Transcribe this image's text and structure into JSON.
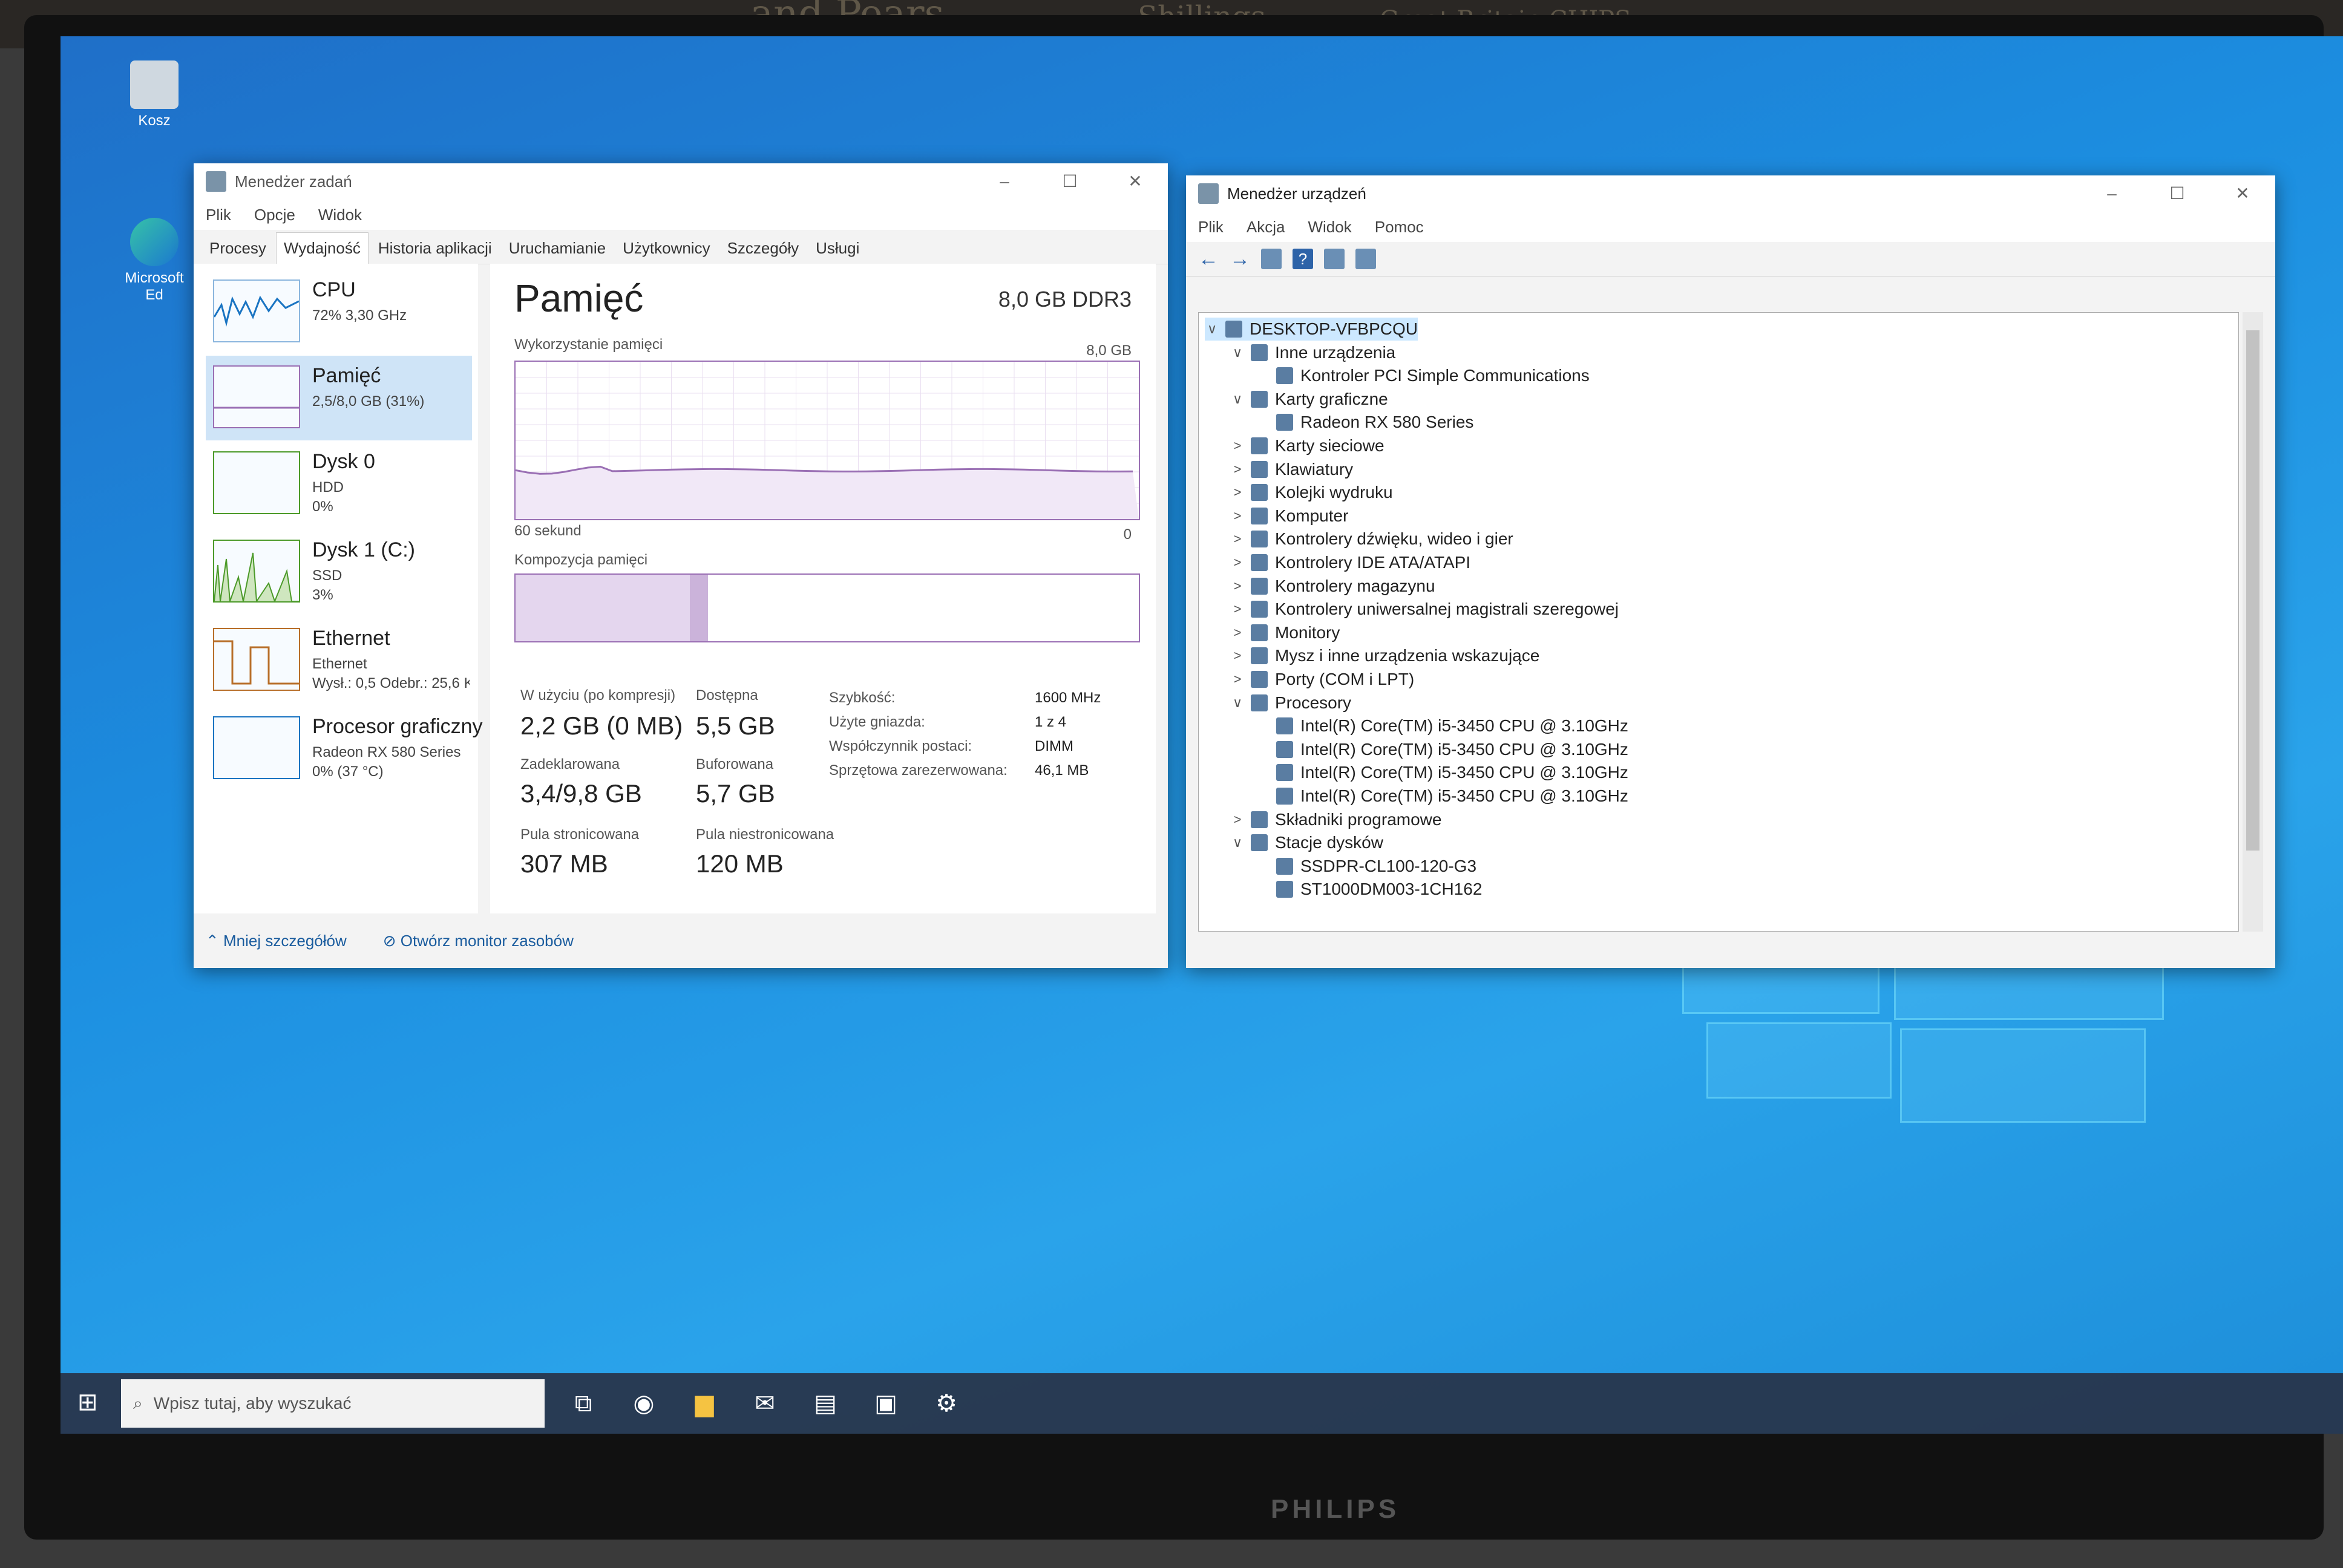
{
  "desktop": {
    "icons": [
      {
        "label": "Kosz"
      },
      {
        "label": "Microsoft Ed"
      }
    ],
    "taskbar": {
      "search_placeholder": "Wpisz tutaj, aby wyszukać"
    },
    "monitor_brand": "PHILIPS",
    "background_books": [
      "and Pears",
      "Shillings",
      "Great Britain CHIPS"
    ]
  },
  "task_manager": {
    "title": "Menedżer zadań",
    "menu": [
      "Plik",
      "Opcje",
      "Widok"
    ],
    "tabs": [
      "Procesy",
      "Wydajność",
      "Historia aplikacji",
      "Uruchamianie",
      "Użytkownicy",
      "Szczegóły",
      "Usługi"
    ],
    "active_tab": "Wydajność",
    "sidebar": [
      {
        "name": "CPU",
        "sub1": "72% 3,30 GHz",
        "sub2": ""
      },
      {
        "name": "Pamięć",
        "sub1": "2,5/8,0 GB (31%)",
        "sub2": ""
      },
      {
        "name": "Dysk 0",
        "sub1": "HDD",
        "sub2": "0%"
      },
      {
        "name": "Dysk 1 (C:)",
        "sub1": "SSD",
        "sub2": "3%"
      },
      {
        "name": "Ethernet",
        "sub1": "Ethernet",
        "sub2": "Wysł.: 0,5 Odebr.: 25,6 K"
      },
      {
        "name": "Procesor graficzny",
        "sub1": "Radeon RX 580 Series",
        "sub2": "0% (37 °C)"
      }
    ],
    "memory": {
      "title": "Pamięć",
      "spec": "8,0 GB DDR3",
      "usage_label": "Wykorzystanie pamięci",
      "usage_max": "8,0 GB",
      "time_label": "60 sekund",
      "time_end": "0",
      "composition_label": "Kompozycja pamięci",
      "in_use_label": "W użyciu (po kompresji)",
      "in_use_value": "2,2 GB (0 MB)",
      "available_label": "Dostępna",
      "available_value": "5,5 GB",
      "committed_label": "Zadeklarowana",
      "committed_value": "3,4/9,8 GB",
      "cached_label": "Buforowana",
      "cached_value": "5,7 GB",
      "paged_label": "Pula stronicowana",
      "paged_value": "307 MB",
      "nonpaged_label": "Pula niestronicowana",
      "nonpaged_value": "120 MB",
      "speed_label": "Szybkość:",
      "speed_value": "1600 MHz",
      "slots_label": "Użyte gniazda:",
      "slots_value": "1 z 4",
      "form_label": "Współczynnik postaci:",
      "form_value": "DIMM",
      "reserved_label": "Sprzętowa zarezerwowana:",
      "reserved_value": "46,1 MB",
      "usage_fraction": 0.31
    },
    "footer": {
      "less": "Mniej szczegółów",
      "monitor": "Otwórz monitor zasobów"
    }
  },
  "device_manager": {
    "title": "Menedżer urządzeń",
    "menu": [
      "Plik",
      "Akcja",
      "Widok",
      "Pomoc"
    ],
    "tree": [
      {
        "label": "DESKTOP-VFBPCQU",
        "exp": "∨",
        "level": 0
      },
      {
        "label": "Inne urządzenia",
        "exp": "∨",
        "level": 1
      },
      {
        "label": "Kontroler PCI Simple Communications",
        "exp": "",
        "level": 2
      },
      {
        "label": "Karty graficzne",
        "exp": "∨",
        "level": 1
      },
      {
        "label": "Radeon RX 580 Series",
        "exp": "",
        "level": 2
      },
      {
        "label": "Karty sieciowe",
        "exp": ">",
        "level": 1
      },
      {
        "label": "Klawiatury",
        "exp": ">",
        "level": 1
      },
      {
        "label": "Kolejki wydruku",
        "exp": ">",
        "level": 1
      },
      {
        "label": "Komputer",
        "exp": ">",
        "level": 1
      },
      {
        "label": "Kontrolery dźwięku, wideo i gier",
        "exp": ">",
        "level": 1
      },
      {
        "label": "Kontrolery IDE ATA/ATAPI",
        "exp": ">",
        "level": 1
      },
      {
        "label": "Kontrolery magazynu",
        "exp": ">",
        "level": 1
      },
      {
        "label": "Kontrolery uniwersalnej magistrali szeregowej",
        "exp": ">",
        "level": 1
      },
      {
        "label": "Monitory",
        "exp": ">",
        "level": 1
      },
      {
        "label": "Mysz i inne urządzenia wskazujące",
        "exp": ">",
        "level": 1
      },
      {
        "label": "Porty (COM i LPT)",
        "exp": ">",
        "level": 1
      },
      {
        "label": "Procesory",
        "exp": "∨",
        "level": 1
      },
      {
        "label": "Intel(R) Core(TM) i5-3450 CPU @ 3.10GHz",
        "exp": "",
        "level": 2
      },
      {
        "label": "Intel(R) Core(TM) i5-3450 CPU @ 3.10GHz",
        "exp": "",
        "level": 2
      },
      {
        "label": "Intel(R) Core(TM) i5-3450 CPU @ 3.10GHz",
        "exp": "",
        "level": 2
      },
      {
        "label": "Intel(R) Core(TM) i5-3450 CPU @ 3.10GHz",
        "exp": "",
        "level": 2
      },
      {
        "label": "Składniki programowe",
        "exp": ">",
        "level": 1
      },
      {
        "label": "Stacje dysków",
        "exp": "∨",
        "level": 1
      },
      {
        "label": "SSDPR-CL100-120-G3",
        "exp": "",
        "level": 2
      },
      {
        "label": "ST1000DM003-1CH162",
        "exp": "",
        "level": 2
      }
    ]
  }
}
